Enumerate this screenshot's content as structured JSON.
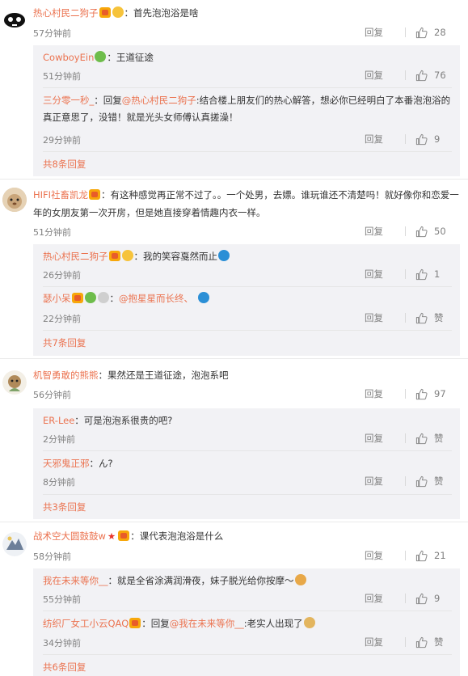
{
  "reply_label": "回复",
  "praise_label": "赞",
  "threads": [
    {
      "user": "热心村民二狗子",
      "text": "：首先泡泡浴是啥",
      "time": "57分钟前",
      "likes": "28",
      "more": "共8条回复",
      "subs": [
        {
          "user": "CowboyEin",
          "text": "：王道征途",
          "time": "51分钟前",
          "likes": "76"
        },
        {
          "user": "三分零一秒_",
          "prefix": "：回复",
          "at": "@热心村民二狗子",
          "text": ":结合楼上朋友们的热心解答，想必你已经明白了本番泡泡浴的真正意思了，没错！就是光头女师傅认真搓澡！",
          "time": "29分钟前",
          "likes": "9"
        }
      ]
    },
    {
      "user": "HIFI社畜凯龙",
      "text": "：有这种感觉再正常不过了。。一个处男，去嫖。谁玩谁还不清楚吗！就好像你和恋爱一年的女朋友第一次开房，但是她直接穿着情趣内衣一样。",
      "time": "51分钟前",
      "likes": "50",
      "more": "共7条回复",
      "subs": [
        {
          "user": "热心村民二狗子",
          "text": "：我的笑容戛然而止",
          "time": "26分钟前",
          "likes": "1"
        },
        {
          "user": "瑟小呆",
          "prefix": "：",
          "at": "@抱星星而长终、",
          "text": "",
          "time": "22分钟前",
          "likes": "赞"
        }
      ]
    },
    {
      "user": "机智勇敢的熊熊",
      "text": "：果然还是王道征途，泡泡系吧",
      "time": "56分钟前",
      "likes": "97",
      "more": "共3条回复",
      "subs": [
        {
          "user": "ER-Lee",
          "text": "：可是泡泡系很贵的吧?",
          "time": "2分钟前",
          "likes": "赞"
        },
        {
          "user": "天邪鬼正邪",
          "text": "：ん?",
          "time": "8分钟前",
          "likes": "赞"
        }
      ]
    },
    {
      "user": "战术空大圆鼓鼓w",
      "text": "：课代表泡泡浴是什么",
      "time": "58分钟前",
      "likes": "21",
      "more": "共6条回复",
      "subs": [
        {
          "user": "我在未来等你__",
          "text": "：就是全省涂满润滑夜，妹子脱光给你按摩～",
          "time": "55分钟前",
          "likes": "9"
        },
        {
          "user": "纺织厂女工小云QAQ",
          "prefix": "：回复",
          "at": "@我在未来等你__",
          "text": ":老实人出现了",
          "time": "34分钟前",
          "likes": "赞"
        }
      ]
    }
  ]
}
